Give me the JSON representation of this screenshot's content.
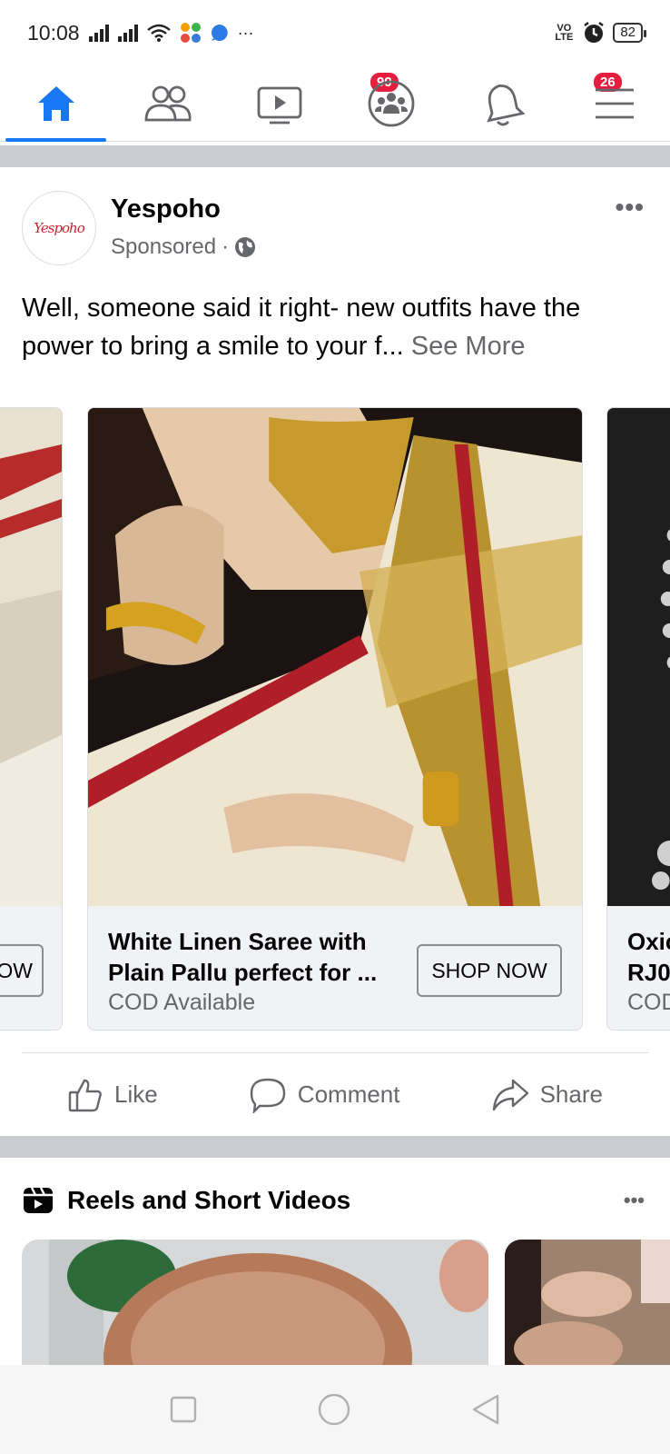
{
  "status_bar": {
    "time": "10:08",
    "more": "···",
    "volte": "VO LTE",
    "battery": "82"
  },
  "nav": {
    "watch_badge": "99",
    "notifications_badge": "26",
    "accent_color": "#1877f2",
    "badge_color": "#e41e3f"
  },
  "post": {
    "page_name": "Yespoho",
    "avatar_text": "Yespoho",
    "sponsored_label": "Sponsored",
    "separator": "·",
    "text": "Well, someone said it right- new outfits have the power to bring a smile to your f...",
    "see_more": "See More"
  },
  "carousel": {
    "left_card": {
      "button_partial": "OW"
    },
    "main_card": {
      "title": "White Linen Saree with Plain Pallu perfect for ...",
      "subtitle": "COD Available",
      "button": "SHOP NOW"
    },
    "right_card": {
      "title_partial_1": "Oxic",
      "title_partial_2": "RJ0",
      "subtitle_partial": "COD"
    }
  },
  "actions": {
    "like": "Like",
    "comment": "Comment",
    "share": "Share"
  },
  "reels": {
    "title": "Reels and Short Videos",
    "more": "•••"
  }
}
